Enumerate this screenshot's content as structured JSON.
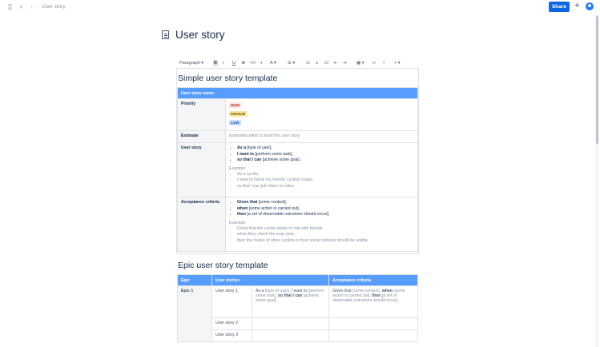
{
  "topbar": {
    "breadcrumb": "User story",
    "share_label": "Share"
  },
  "page": {
    "title": "User story"
  },
  "toolbar": {
    "paragraph": "Paragraph"
  },
  "simple": {
    "heading": "Simple user story template",
    "header": "User story name:",
    "priority_label": "Priority",
    "tags": {
      "high": "HIGH",
      "medium": "MEDIUM",
      "low": "LOW"
    },
    "estimate_label": "Estimate",
    "estimate_placeholder": "Estimated effort to build this user story",
    "userstory_label": "User story",
    "as_a": "As a",
    "as_a_rest": " [type of user],",
    "i_want": "I want to",
    "i_want_rest": " [perform some task],",
    "so_that": "so that I can",
    "so_that_rest": " [achieve some goal].",
    "example_label": "Example:",
    "ex_as_rest": " cyclist,",
    "ex_want_rest": " follow my friends' cycling routes,",
    "ex_so_rest": " join them on rides.",
    "acceptance_label": "Acceptance criteria",
    "given": "Given that",
    "given_rest": " [some context],",
    "when": "when",
    "when_rest": " [some action is carried out],",
    "then": "then",
    "then_rest": " [a set of observable outcomes should occur].",
    "ex_given_rest": " the cyclist wants to ride with friends,",
    "ex_when_rest": " they check the map view,",
    "ex_then_rest": " the routes of other cyclists in their social network should be visible."
  },
  "epic": {
    "heading": "Epic user story template",
    "col_epic": "Epic",
    "col_stories": "User stories",
    "col_acceptance": "Acceptance criteria",
    "epic1": "Epic 1",
    "story1": "User story 1",
    "story2": "User story 2",
    "story3": "User story 3",
    "story1_desc_a": "As a",
    "story1_desc_a_rest": " [type of user], ",
    "story1_desc_b": "I want to",
    "story1_desc_b_rest": " [perform some task], ",
    "story1_desc_c": "so that I can",
    "story1_desc_c_rest": " [achieve some goal].",
    "acc1_a": "Given that",
    "acc1_a_rest": " [some context], ",
    "acc1_b": "when",
    "acc1_b_rest": " [some action is carried out], ",
    "acc1_c": "then",
    "acc1_c_rest": " [a set of observable outcomes should occur]."
  },
  "colors": {
    "accent": "#0c66e4",
    "table_header": "#579dff",
    "row_header": "#f4f5f7"
  }
}
